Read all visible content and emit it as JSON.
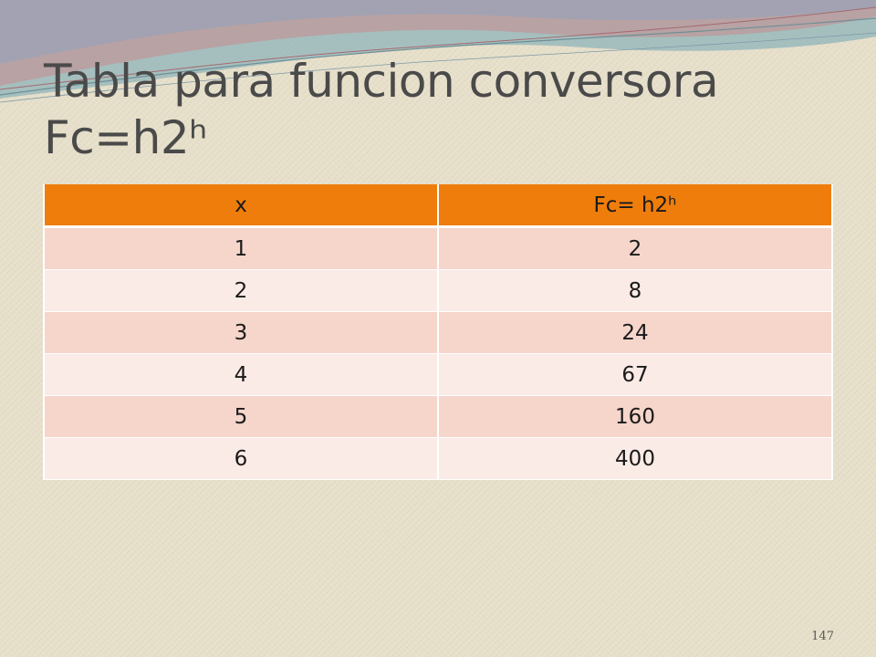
{
  "slide": {
    "title_line1": "Tabla para funcion conversora",
    "title_line2": "Fc=h2ʰ",
    "page_number": "147"
  },
  "table": {
    "headers": [
      "x",
      "Fc= h2ʰ"
    ],
    "rows": [
      [
        "1",
        "2"
      ],
      [
        "2",
        "8"
      ],
      [
        "3",
        "24"
      ],
      [
        "4",
        "67"
      ],
      [
        "5",
        "160"
      ],
      [
        "6",
        "400"
      ]
    ]
  },
  "colors": {
    "background": "#e6dfca",
    "header_fill": "#ef7d0b",
    "row_odd": "#f6d5cb",
    "row_even": "#fbebe6",
    "title_text": "#4a4a4a",
    "deco_teal": "#7fa8b0",
    "deco_pink": "#c98a8e"
  }
}
